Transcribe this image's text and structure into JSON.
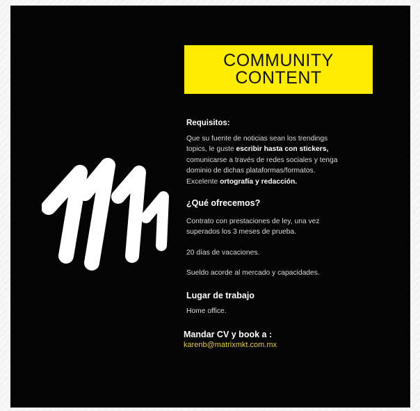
{
  "title": {
    "line1": "COMMUNITY",
    "line2": "CONTENT"
  },
  "requisitos": {
    "heading": "Requisitos:",
    "p1": "Que su fuente de noticias sean los trendings",
    "p2a": "topics, le guste ",
    "p2b": "escribir hasta con stickers,",
    "p3": "comunicarse a través de  redes sociales y tenga",
    "p4": "dominio de dichas plataformas/formatos.",
    "p5a": "Excelente ",
    "p5b": "ortografía y redacción."
  },
  "ofrecemos": {
    "heading": "¿Qué ofrecemos?",
    "p1": "Contrato con prestaciones de ley, una vez",
    "p2": "superados los 3 meses de prueba.",
    "p3": "20 días de vacaciones.",
    "p4": "Sueldo acorde al mercado y capacidades."
  },
  "lugar": {
    "heading": "Lugar de trabajo",
    "value": "Home office."
  },
  "contacto": {
    "heading": "Mandar CV y book a :",
    "email": "karenb@matrixmkt.com.mx"
  },
  "colors": {
    "accent": "#ffec00",
    "background": "#040404",
    "email": "#e6c84a"
  },
  "logo": "matrix-m-brush-logo"
}
